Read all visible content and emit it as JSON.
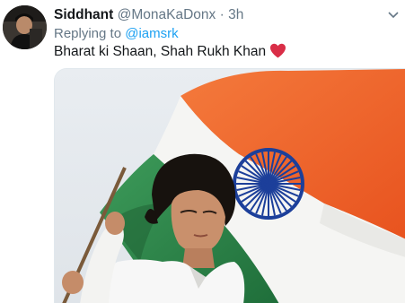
{
  "tweet": {
    "display_name": "Siddhant",
    "handle": "@MonaKaDonx",
    "separator": "·",
    "time": "3h",
    "replying_prefix": "Replying to",
    "replying_to": "@iamsrk",
    "text": "Bharat ki Shaan, Shah Rukh Khan",
    "emoji": "heart-emoji"
  },
  "icons": {
    "more": "chevron-down-icon",
    "heart": "red-heart-icon"
  },
  "colors": {
    "link": "#1da1f2",
    "muted": "#657786",
    "text": "#14171a",
    "heart": "#e0245e",
    "saffron": "#f26a2e",
    "green": "#2e8b4a",
    "chakra": "#1c3f9a"
  }
}
